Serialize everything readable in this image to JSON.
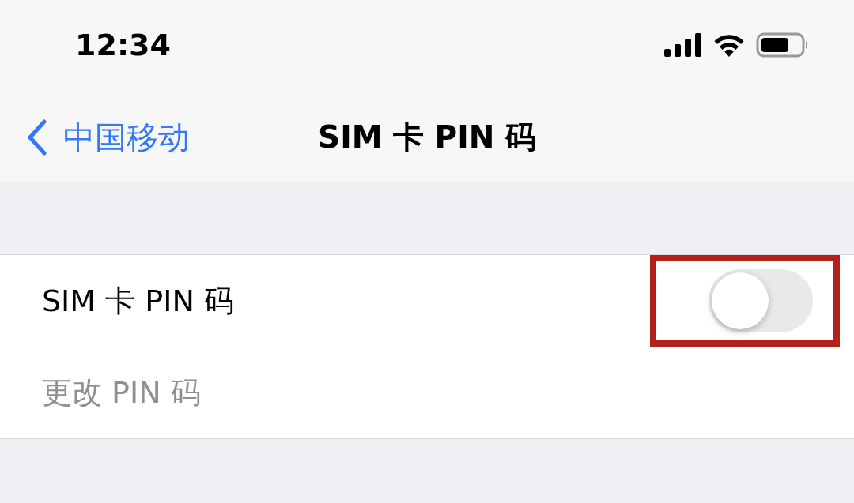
{
  "status_bar": {
    "time": "12:34"
  },
  "nav": {
    "back_label": "中国移动",
    "title": "SIM 卡 PIN 码"
  },
  "rows": [
    {
      "kind": "toggle",
      "label": "SIM 卡 PIN 码",
      "on": false,
      "disabled": false,
      "highlighted": true
    },
    {
      "kind": "link",
      "label": "更改 PIN 码",
      "disabled": true,
      "highlighted": false
    }
  ]
}
